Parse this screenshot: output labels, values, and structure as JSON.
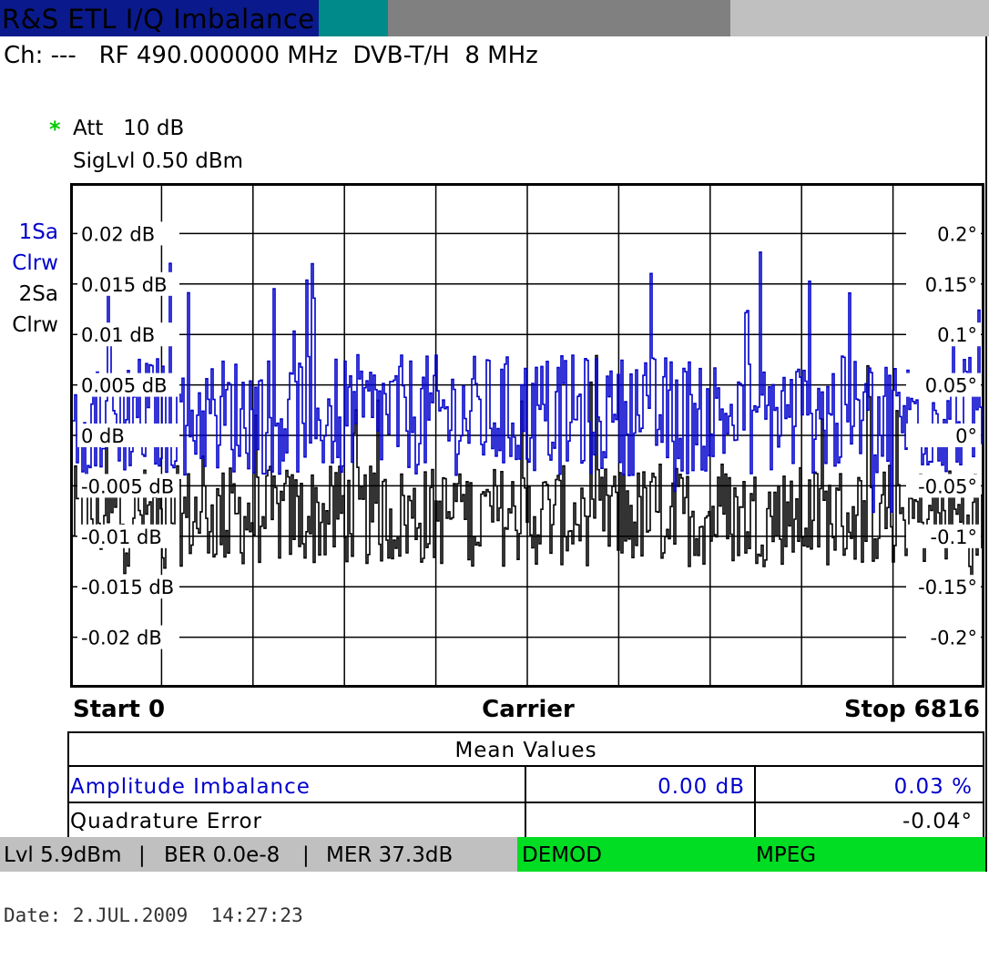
{
  "window": {
    "title": "R&S ETL I/Q Imbalance",
    "title_colors": {
      "navy": "#0a1a8c",
      "teal": "#008a8a",
      "gray": "#808080",
      "light_gray": "#c0c0c0"
    }
  },
  "header": {
    "channel": "Ch: ---   RF 490.000000 MHz  DVB-T/H  8 MHz",
    "att_marker": "*",
    "att": "Att   10 dB",
    "siglvl": "SigLvl 0.50 dBm"
  },
  "traces": {
    "t1_name": "1Sa",
    "t1_mode": "Clrw",
    "t2_name": "2Sa",
    "t2_mode": "Clrw",
    "t1_color": "#0000cc",
    "t2_color": "#000000"
  },
  "chart_data": {
    "type": "line",
    "xlabel": "Carrier",
    "x_start_label": "Start 0",
    "x_stop_label": "Stop 6816",
    "xlim": [
      0,
      6816
    ],
    "y_left_ticks": [
      "0.02 dB",
      "0.015 dB",
      "0.01 dB",
      "0.005 dB",
      "0 dB",
      "-0.005 dB",
      "-0.01 dB",
      "-0.015 dB",
      "-0.02 dB"
    ],
    "y_right_ticks": [
      "0.2°",
      "0.15°",
      "0.1°",
      "0.05°",
      "0°",
      "-0.05°",
      "-0.1°",
      "-0.15°",
      "-0.2°"
    ],
    "y_left_range_db": [
      -0.025,
      0.025
    ],
    "y_right_range_deg": [
      -0.25,
      0.25
    ],
    "grid": true,
    "series": [
      {
        "name": "1Sa",
        "color": "#0000cc",
        "unit": "dB",
        "mean": 0.002,
        "spread": 0.012
      },
      {
        "name": "2Sa",
        "color": "#000000",
        "unit": "deg",
        "mean": -0.08,
        "spread": 0.1
      }
    ]
  },
  "axis": {
    "start": "Start 0",
    "center": "Carrier",
    "stop": "Stop 6816"
  },
  "mean_values": {
    "header": "Mean Values",
    "amp_label": "Amplitude Imbalance",
    "amp_db": "0.00 dB",
    "amp_pct": "0.03 %",
    "quad_label": "Quadrature Error",
    "quad_deg": "-0.04°",
    "amp_color": "#0000cc"
  },
  "status": {
    "lvl": "Lvl 5.9dBm",
    "ber": "BER 0.0e-8",
    "mer": "MER 37.3dB",
    "demod": "DEMOD",
    "mpeg": "MPEG",
    "green": "#00dd22",
    "gray": "#c0c0c0"
  },
  "footer": {
    "date": "Date: 2.JUL.2009  14:27:23"
  }
}
